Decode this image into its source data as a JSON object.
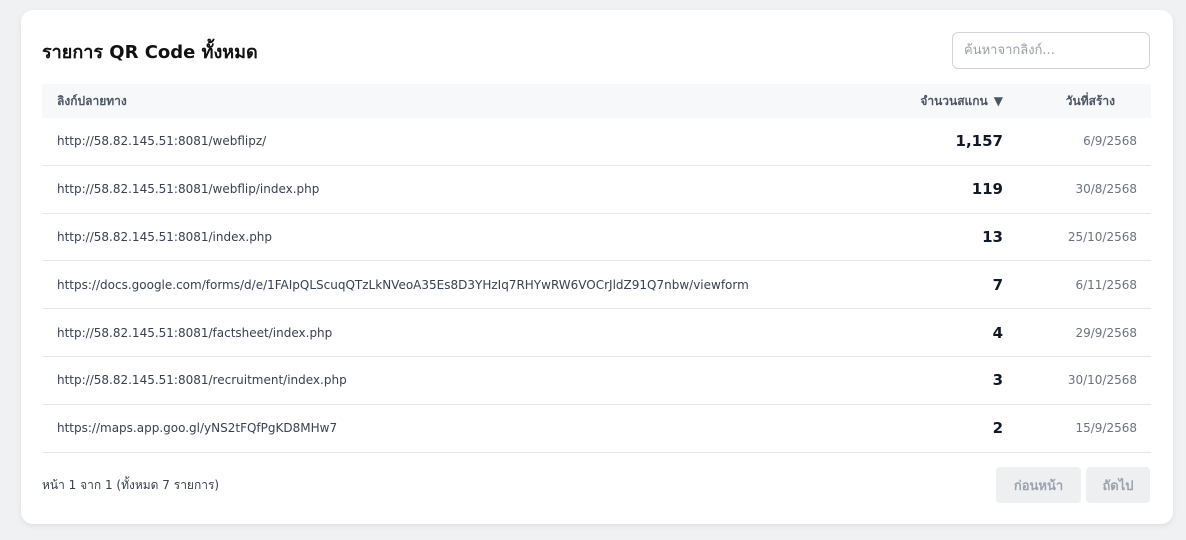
{
  "header": {
    "title": "รายการ QR Code ทั้งหมด",
    "search_placeholder": "ค้นหาจากลิงก์..."
  },
  "table": {
    "columns": {
      "link": "ลิงก์ปลายทาง",
      "scans": "จำนวนสแกน",
      "sort_indicator": "▼",
      "created": "วันที่สร้าง"
    },
    "rows": [
      {
        "link": "http://58.82.145.51:8081/webflipz/",
        "scans": "1,157",
        "created": "6/9/2568"
      },
      {
        "link": "http://58.82.145.51:8081/webflip/index.php",
        "scans": "119",
        "created": "30/8/2568"
      },
      {
        "link": "http://58.82.145.51:8081/index.php",
        "scans": "13",
        "created": "25/10/2568"
      },
      {
        "link": "https://docs.google.com/forms/d/e/1FAIpQLScuqQTzLkNVeoA35Es8D3YHzIq7RHYwRW6VOCrJldZ91Q7nbw/viewform",
        "scans": "7",
        "created": "6/11/2568"
      },
      {
        "link": "http://58.82.145.51:8081/factsheet/index.php",
        "scans": "4",
        "created": "29/9/2568"
      },
      {
        "link": "http://58.82.145.51:8081/recruitment/index.php",
        "scans": "3",
        "created": "30/10/2568"
      },
      {
        "link": "https://maps.app.goo.gl/yNS2tFQfPgKD8MHw7",
        "scans": "2",
        "created": "15/9/2568"
      }
    ]
  },
  "pagination": {
    "info": "หน้า 1 จาก 1 (ทั้งหมด 7 รายการ)",
    "prev_label": "ก่อนหน้า",
    "next_label": "ถัดไป"
  }
}
